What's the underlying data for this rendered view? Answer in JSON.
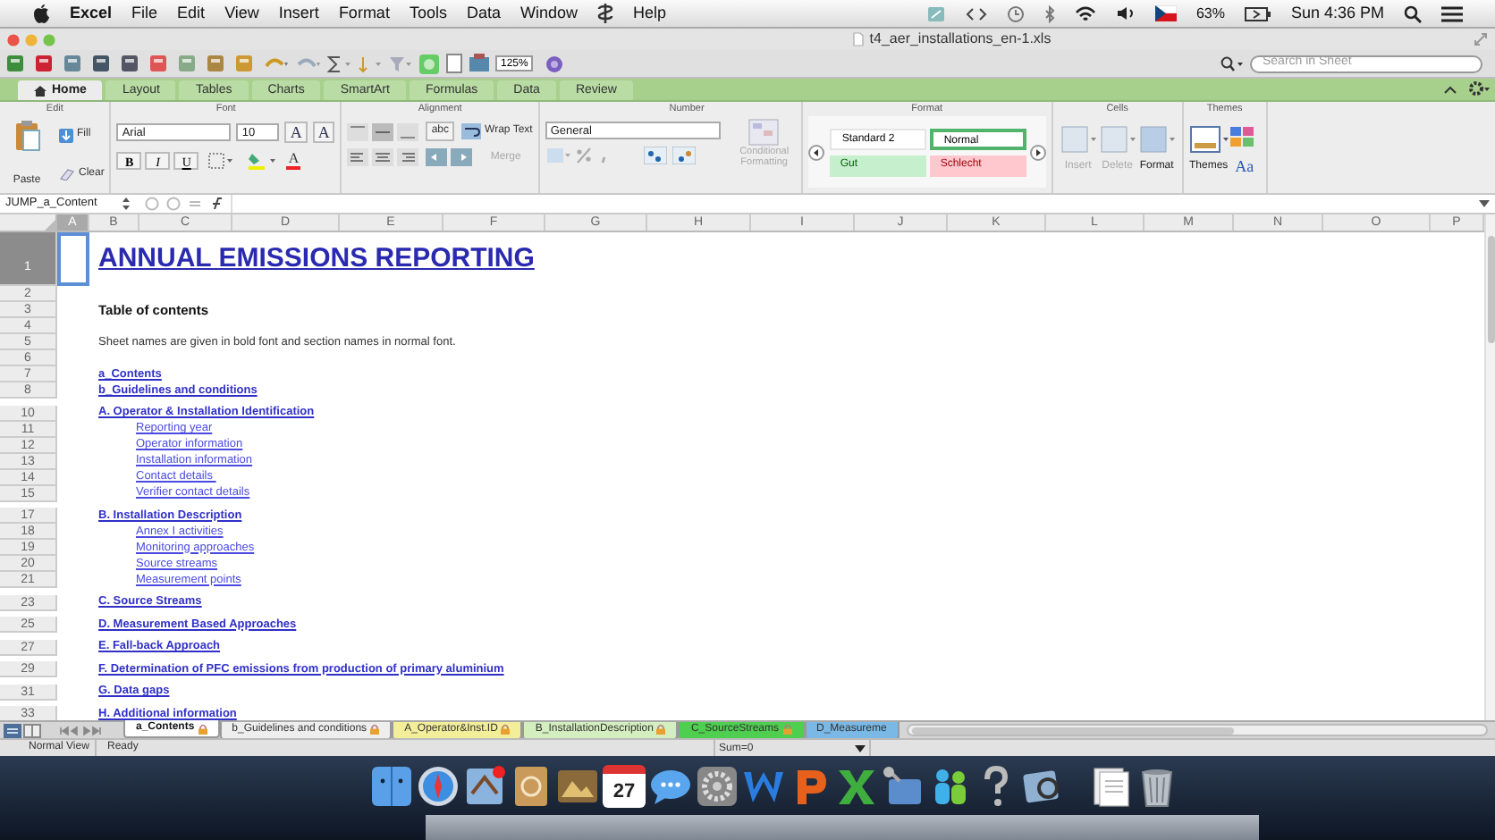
{
  "menu_bar": {
    "items": [
      {
        "kind": "app",
        "label": "Excel"
      },
      {
        "kind": "menu",
        "label": "File"
      },
      {
        "kind": "menu",
        "label": "Edit"
      },
      {
        "kind": "menu",
        "label": "View"
      },
      {
        "kind": "menu",
        "label": "Insert"
      },
      {
        "kind": "menu",
        "label": "Format"
      },
      {
        "kind": "menu",
        "label": "Tools"
      },
      {
        "kind": "menu",
        "label": "Data"
      },
      {
        "kind": "menu",
        "label": "Window"
      },
      {
        "kind": "script"
      },
      {
        "kind": "menu",
        "label": "Help"
      }
    ],
    "battery": "63%",
    "clock": "Sun 4:36 PM"
  },
  "window": {
    "title": "t4_aer_installations_en-1.xls"
  },
  "toolbar": {
    "zoom": "125%",
    "search": {
      "placeholder": "Search in Sheet"
    }
  },
  "ribbon_tabs": [
    {
      "label": "Home",
      "selected": true
    },
    {
      "label": "Layout",
      "selected": false
    },
    {
      "label": "Tables",
      "selected": false
    },
    {
      "label": "Charts",
      "selected": false
    },
    {
      "label": "SmartArt",
      "selected": false
    },
    {
      "label": "Formulas",
      "selected": false
    },
    {
      "label": "Data",
      "selected": false
    },
    {
      "label": "Review",
      "selected": false
    }
  ],
  "ribbon": {
    "groups": [
      "Edit",
      "Font",
      "Alignment",
      "Number",
      "Format",
      "Cells",
      "Themes"
    ],
    "paste": "Paste",
    "fill": "Fill",
    "clear": "Clear",
    "font": "Arial",
    "font_size": "10",
    "grow": "A",
    "shrink": "A",
    "bold": "B",
    "italic": "I",
    "underline": "U",
    "font_color": "A",
    "orientation": "abc",
    "wrap_text": "Wrap Text",
    "merge": {
      "label": "Merge",
      "disabled": true
    },
    "number_format": "General",
    "conditional_formatting": {
      "label": "Conditional Formatting",
      "disabled": true
    },
    "styles": [
      {
        "label": "Standard 2",
        "kind": "standard"
      },
      {
        "label": "Normal",
        "kind": "normal"
      },
      {
        "label": "Gut",
        "kind": "good"
      },
      {
        "label": "Schlecht",
        "kind": "bad"
      }
    ],
    "insert": {
      "label": "Insert",
      "disabled": true
    },
    "delete": {
      "label": "Delete",
      "disabled": true
    },
    "format": {
      "label": "Format",
      "disabled": false
    },
    "themes": "Themes",
    "theme_fonts": "Aa"
  },
  "formula_bar": {
    "name_box": "JUMP_a_Content"
  },
  "columns": [
    {
      "label": "A",
      "selected": true
    },
    {
      "label": "B",
      "selected": false
    },
    {
      "label": "C",
      "selected": false
    },
    {
      "label": "D",
      "selected": false
    },
    {
      "label": "E",
      "selected": false
    },
    {
      "label": "F",
      "selected": false
    },
    {
      "label": "G",
      "selected": false
    },
    {
      "label": "H",
      "selected": false
    },
    {
      "label": "I",
      "selected": false
    },
    {
      "label": "J",
      "selected": false
    },
    {
      "label": "K",
      "selected": false
    },
    {
      "label": "L",
      "selected": false
    },
    {
      "label": "M",
      "selected": false
    },
    {
      "label": "N",
      "selected": false
    },
    {
      "label": "O",
      "selected": false
    },
    {
      "label": "P",
      "selected": false
    }
  ],
  "rows": [
    {
      "number": "1",
      "kind": "title",
      "text": "ANNUAL EMISSIONS REPORTING",
      "selected": true
    },
    {
      "number": "2",
      "kind": "empty",
      "selected": false
    },
    {
      "number": "3",
      "kind": "heading",
      "text": "Table of contents",
      "selected": false
    },
    {
      "number": "4",
      "kind": "empty",
      "selected": false
    },
    {
      "number": "5",
      "kind": "note",
      "text": "Sheet names are given in bold font and section names in normal font.",
      "selected": false
    },
    {
      "number": "6",
      "kind": "empty",
      "selected": false
    },
    {
      "number": "7",
      "kind": "sheet_link",
      "text": "a_Contents",
      "selected": false
    },
    {
      "number": "8",
      "kind": "sheet_link",
      "text": "b_Guidelines and conditions",
      "selected": false
    },
    {
      "number": "10",
      "kind": "sheet_link",
      "text": "A. Operator & Installation Identification",
      "selected": false
    },
    {
      "number": "11",
      "kind": "section_link",
      "text": "Reporting year",
      "selected": false
    },
    {
      "number": "12",
      "kind": "section_link",
      "text": "Operator information",
      "selected": false
    },
    {
      "number": "13",
      "kind": "section_link",
      "text": "Installation information",
      "selected": false
    },
    {
      "number": "14",
      "kind": "section_link",
      "text": "Contact details ",
      "selected": false
    },
    {
      "number": "15",
      "kind": "section_link",
      "text": "Verifier contact details",
      "selected": false
    },
    {
      "number": "17",
      "kind": "sheet_link",
      "text": "B. Installation Description",
      "selected": false
    },
    {
      "number": "18",
      "kind": "section_link",
      "text": "Annex I activities",
      "selected": false
    },
    {
      "number": "19",
      "kind": "section_link",
      "text": "Monitoring approaches",
      "selected": false
    },
    {
      "number": "20",
      "kind": "section_link",
      "text": "Source streams",
      "selected": false
    },
    {
      "number": "21",
      "kind": "section_link",
      "text": "Measurement points",
      "selected": false
    },
    {
      "number": "23",
      "kind": "sheet_link",
      "text": "C. Source Streams",
      "selected": false
    },
    {
      "number": "25",
      "kind": "sheet_link",
      "text": "D. Measurement Based Approaches",
      "selected": false
    },
    {
      "number": "27",
      "kind": "sheet_link",
      "text": "E. Fall-back Approach",
      "selected": false
    },
    {
      "number": "29",
      "kind": "sheet_link",
      "text": "F. Determination of PFC emissions from production of primary aluminium",
      "selected": false
    },
    {
      "number": "31",
      "kind": "sheet_link",
      "text": "G. Data gaps",
      "selected": false
    },
    {
      "number": "33",
      "kind": "sheet_link",
      "text": "H. Additional information",
      "selected": false
    }
  ],
  "sheet_tabs": [
    {
      "label": "a_Contents",
      "selected": true,
      "color": "#ffffff"
    },
    {
      "label": "b_Guidelines and conditions",
      "selected": false,
      "color": "#eeeeee"
    },
    {
      "label": "A_Operator&Inst.ID",
      "selected": false,
      "color": "#f3ee9a"
    },
    {
      "label": "B_InstallationDescription",
      "selected": false,
      "color": "#d4efbf"
    },
    {
      "label": "C_SourceStreams",
      "selected": false,
      "color": "#4fcf4f"
    },
    {
      "label": "D_Measureme",
      "selected": false,
      "color": "#7ab8e6"
    }
  ],
  "status_bar": {
    "view": "Normal View",
    "status": "Ready",
    "sum": "Sum=0"
  },
  "dock": {
    "apps": [
      {
        "kind": "finder"
      },
      {
        "kind": "browser"
      },
      {
        "kind": "mail"
      },
      {
        "kind": "contacts"
      },
      {
        "kind": "photos"
      },
      {
        "kind": "calendar",
        "label": "27"
      },
      {
        "kind": "chat"
      },
      {
        "kind": "preferences"
      },
      {
        "kind": "word"
      },
      {
        "kind": "powerpoint"
      },
      {
        "kind": "excel"
      },
      {
        "kind": "network"
      },
      {
        "kind": "messenger"
      },
      {
        "kind": "help"
      },
      {
        "kind": "preview"
      },
      {
        "kind": "documents"
      },
      {
        "kind": "trash"
      }
    ]
  }
}
